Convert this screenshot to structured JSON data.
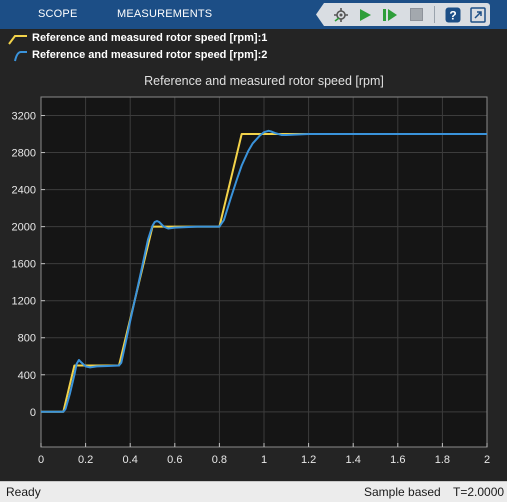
{
  "toolstrip": {
    "tabs": [
      {
        "label": "SCOPE"
      },
      {
        "label": "MEASUREMENTS"
      }
    ],
    "buttons": [
      {
        "icon": "step-back-icon"
      },
      {
        "icon": "run-icon"
      },
      {
        "icon": "step-forward-icon"
      },
      {
        "icon": "stop-icon"
      },
      {
        "icon": "help-icon"
      },
      {
        "icon": "undock-icon"
      }
    ]
  },
  "legend": [
    {
      "label": "Reference and measured rotor speed [rpm]:1",
      "color": "#f3d34a"
    },
    {
      "label": "Reference and measured rotor speed [rpm]:2",
      "color": "#3a93db"
    }
  ],
  "chart_data": {
    "type": "line",
    "title": "Reference and measured rotor speed [rpm]",
    "xlabel": "",
    "ylabel": "",
    "xlim": [
      0,
      2
    ],
    "ylim": [
      -380,
      3400
    ],
    "xticks": [
      0,
      0.2,
      0.4,
      0.6,
      0.8,
      1,
      1.2,
      1.4,
      1.6,
      1.8,
      2
    ],
    "xtick_labels": [
      "0",
      "0.2",
      "0.4",
      "0.6",
      "0.8",
      "1",
      "1.2",
      "1.4",
      "1.6",
      "1.8",
      "2"
    ],
    "yticks": [
      0,
      400,
      800,
      1200,
      1600,
      2000,
      2400,
      2800,
      3200
    ],
    "ytick_labels": [
      "0",
      "400",
      "800",
      "1200",
      "1600",
      "2000",
      "2400",
      "2800",
      "3200"
    ],
    "grid": true,
    "legend_position": "top-left, above axes",
    "series": [
      {
        "name": "Reference and measured rotor speed [rpm]:1",
        "color": "#f3d34a",
        "x": [
          0,
          0.1,
          0.15,
          0.35,
          0.5,
          0.8,
          0.9,
          2
        ],
        "y": [
          0,
          0,
          500,
          500,
          2000,
          2000,
          3000,
          3000
        ]
      },
      {
        "name": "Reference and measured rotor speed [rpm]:2",
        "color": "#3a93db",
        "x": [
          0,
          0.1,
          0.11,
          0.13,
          0.15,
          0.16,
          0.17,
          0.18,
          0.2,
          0.22,
          0.25,
          0.3,
          0.35,
          0.36,
          0.38,
          0.4,
          0.45,
          0.48,
          0.5,
          0.51,
          0.52,
          0.53,
          0.55,
          0.57,
          0.6,
          0.7,
          0.8,
          0.82,
          0.85,
          0.88,
          0.9,
          0.93,
          0.95,
          0.98,
          1.0,
          1.02,
          1.03,
          1.05,
          1.08,
          1.1,
          1.2,
          1.5,
          2.0
        ],
        "y": [
          0,
          0,
          30,
          200,
          400,
          520,
          560,
          535,
          490,
          480,
          490,
          495,
          500,
          530,
          750,
          980,
          1530,
          1860,
          2010,
          2050,
          2060,
          2050,
          2000,
          1980,
          1990,
          2000,
          2000,
          2070,
          2300,
          2520,
          2660,
          2820,
          2900,
          2980,
          3020,
          3035,
          3030,
          3010,
          2990,
          2990,
          3000,
          3000,
          3000
        ]
      }
    ]
  },
  "status": {
    "ready": "Ready",
    "sample": "Sample based",
    "time": "T=2.0000"
  }
}
